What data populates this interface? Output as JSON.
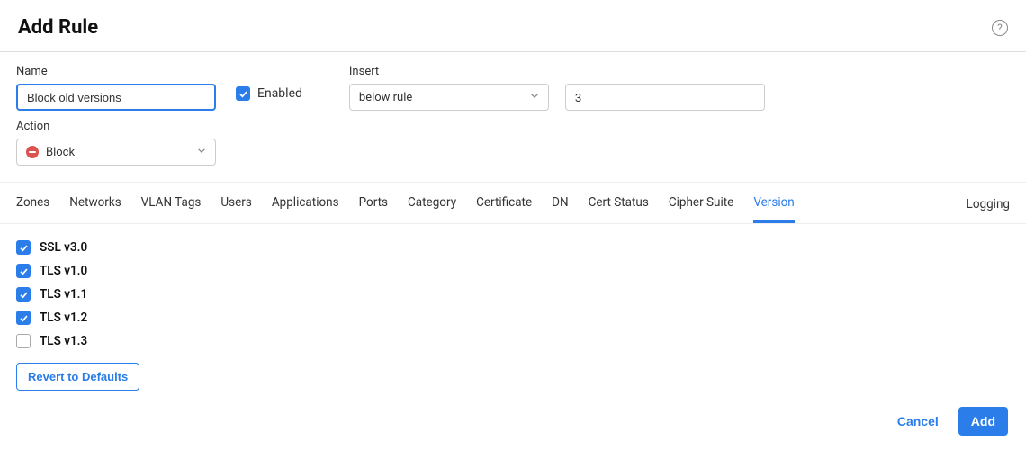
{
  "header": {
    "title": "Add Rule"
  },
  "form": {
    "name_label": "Name",
    "name_value": "Block old versions",
    "enabled_label": "Enabled",
    "enabled_checked": true,
    "insert_label": "Insert",
    "insert_position": "below rule",
    "insert_number": "3",
    "action_label": "Action",
    "action_value": "Block"
  },
  "tabs": {
    "items": [
      {
        "label": "Zones",
        "active": false
      },
      {
        "label": "Networks",
        "active": false
      },
      {
        "label": "VLAN Tags",
        "active": false
      },
      {
        "label": "Users",
        "active": false
      },
      {
        "label": "Applications",
        "active": false
      },
      {
        "label": "Ports",
        "active": false
      },
      {
        "label": "Category",
        "active": false
      },
      {
        "label": "Certificate",
        "active": false
      },
      {
        "label": "DN",
        "active": false
      },
      {
        "label": "Cert Status",
        "active": false
      },
      {
        "label": "Cipher Suite",
        "active": false
      },
      {
        "label": "Version",
        "active": true
      }
    ],
    "logging_label": "Logging"
  },
  "versions": {
    "items": [
      {
        "label": "SSL v3.0",
        "checked": true
      },
      {
        "label": "TLS v1.0",
        "checked": true
      },
      {
        "label": "TLS v1.1",
        "checked": true
      },
      {
        "label": "TLS v1.2",
        "checked": true
      },
      {
        "label": "TLS v1.3",
        "checked": false
      }
    ],
    "revert_label": "Revert to Defaults"
  },
  "footer": {
    "cancel_label": "Cancel",
    "add_label": "Add"
  }
}
